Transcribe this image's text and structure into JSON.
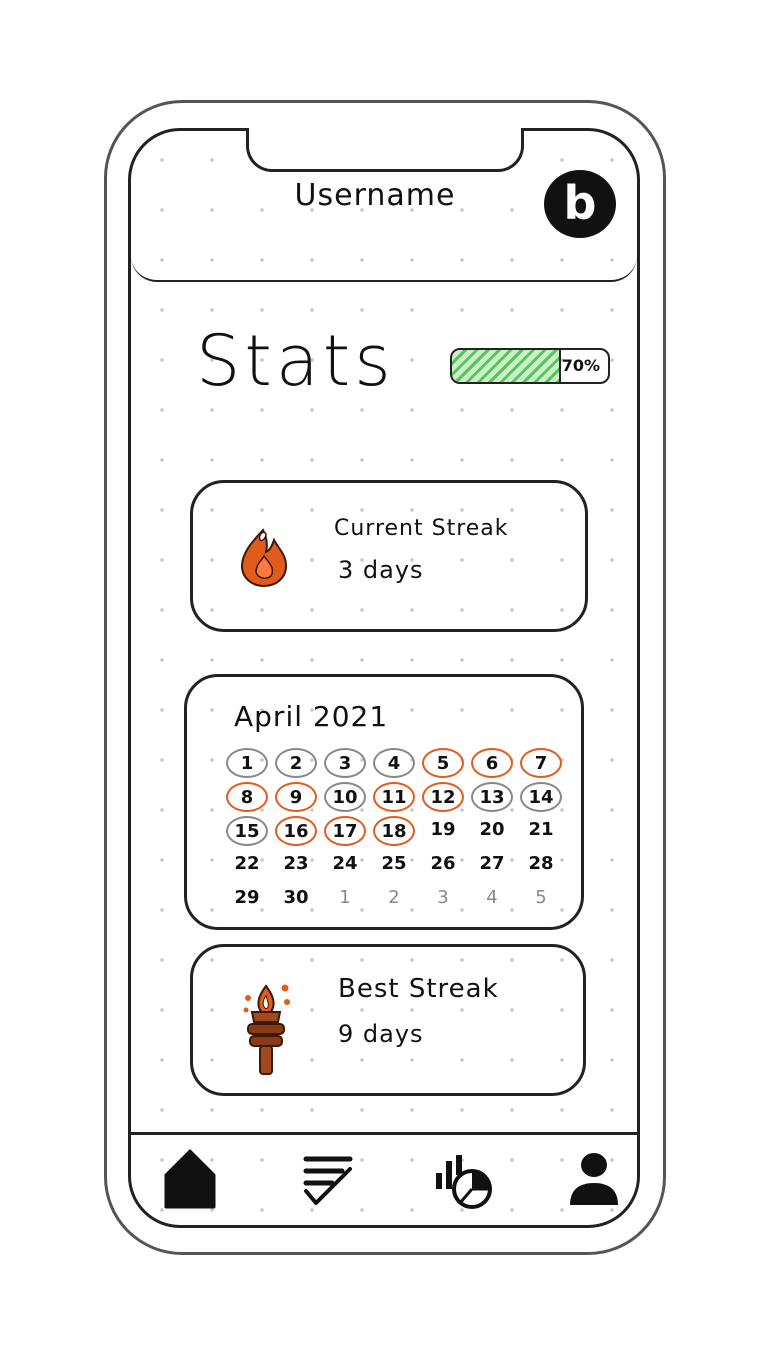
{
  "header": {
    "username": "Username",
    "avatar_letter": "b",
    "avatar_icon": "user-avatar"
  },
  "stats": {
    "title": "Stats",
    "progress": {
      "label": "70%",
      "value": 0.7,
      "fill_color": "#59c45c"
    }
  },
  "current_streak": {
    "icon": "flame-icon",
    "title": "Current Streak",
    "value": "3 days",
    "accent": "#e35b1c"
  },
  "calendar": {
    "title": "April 2021",
    "completed_color": "#e35b1c",
    "partial_color": "#888888",
    "weeks": [
      [
        {
          "d": "1",
          "s": "partial"
        },
        {
          "d": "2",
          "s": "partial"
        },
        {
          "d": "3",
          "s": "partial"
        },
        {
          "d": "4",
          "s": "partial"
        },
        {
          "d": "5",
          "s": "completed"
        },
        {
          "d": "6",
          "s": "completed"
        },
        {
          "d": "7",
          "s": "completed"
        }
      ],
      [
        {
          "d": "8",
          "s": "completed"
        },
        {
          "d": "9",
          "s": "completed"
        },
        {
          "d": "10",
          "s": "partial"
        },
        {
          "d": "11",
          "s": "completed"
        },
        {
          "d": "12",
          "s": "completed"
        },
        {
          "d": "13",
          "s": "partial"
        },
        {
          "d": "14",
          "s": "partial"
        }
      ],
      [
        {
          "d": "15",
          "s": "partial"
        },
        {
          "d": "16",
          "s": "completed"
        },
        {
          "d": "17",
          "s": "completed"
        },
        {
          "d": "18",
          "s": "completed"
        },
        {
          "d": "19",
          "s": "none"
        },
        {
          "d": "20",
          "s": "none"
        },
        {
          "d": "21",
          "s": "none"
        }
      ],
      [
        {
          "d": "22",
          "s": "none"
        },
        {
          "d": "23",
          "s": "none"
        },
        {
          "d": "24",
          "s": "none"
        },
        {
          "d": "25",
          "s": "none"
        },
        {
          "d": "26",
          "s": "none"
        },
        {
          "d": "27",
          "s": "none"
        },
        {
          "d": "28",
          "s": "none"
        }
      ],
      [
        {
          "d": "29",
          "s": "none"
        },
        {
          "d": "30",
          "s": "none"
        },
        {
          "d": "1",
          "s": "next"
        },
        {
          "d": "2",
          "s": "next"
        },
        {
          "d": "3",
          "s": "next"
        },
        {
          "d": "4",
          "s": "next"
        },
        {
          "d": "5",
          "s": "next"
        }
      ]
    ]
  },
  "best_streak": {
    "icon": "torch-icon",
    "title": "Best Streak",
    "value": "9 days"
  },
  "tabbar": {
    "items": [
      {
        "icon": "home-icon"
      },
      {
        "icon": "tasks-icon"
      },
      {
        "icon": "stats-icon"
      },
      {
        "icon": "profile-icon"
      }
    ]
  }
}
